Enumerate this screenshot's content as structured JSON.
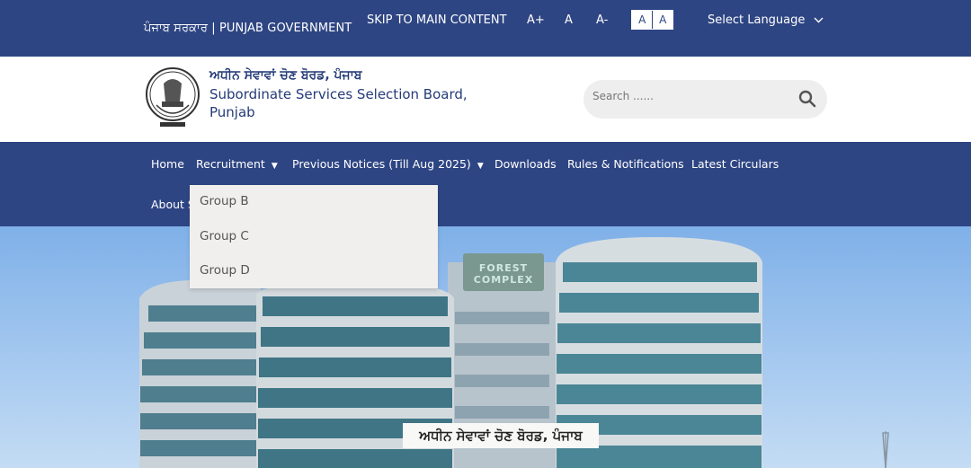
{
  "topbar": {
    "government": "ਪੰਜਾਬ ਸਰਕਾਰ | PUNJAB GOVERNMENT",
    "skip_link": "SKIP TO MAIN CONTENT",
    "font_increase": "A+",
    "font_normal": "A",
    "font_decrease": "A-",
    "contrast_light": "A",
    "contrast_dark": "A",
    "language": "Select Language"
  },
  "header": {
    "title_punjabi": "ਅਧੀਨ ਸੇਵਾਵਾਂ ਚੋਣ ਬੋਰਡ, ਪੰਜਾਬ",
    "title_english": "Subordinate Services Selection Board, Punjab",
    "search_placeholder": "Search ......"
  },
  "nav": {
    "items": [
      {
        "label": "Home"
      },
      {
        "label": "Recruitment"
      },
      {
        "label": "Previous Notices (Till Aug 2025)"
      },
      {
        "label": "Downloads"
      },
      {
        "label": "Rules & Notifications"
      },
      {
        "label": "Latest Circulars"
      },
      {
        "label": "About S"
      }
    ]
  },
  "dropdown": {
    "items": [
      {
        "label": "Group B"
      },
      {
        "label": "Group C"
      },
      {
        "label": "Group D"
      }
    ]
  },
  "hero": {
    "building_sign": "FOREST COMPLEX",
    "banner": "ਅਧੀਨ ਸੇਵਾਵਾਂ ਚੋਣ ਬੋਰਡ, ਪੰਜਾਬ"
  },
  "colors": {
    "primary": "#2e4583",
    "dropdown_bg": "#f0efed",
    "search_bg": "#eeeeee"
  }
}
